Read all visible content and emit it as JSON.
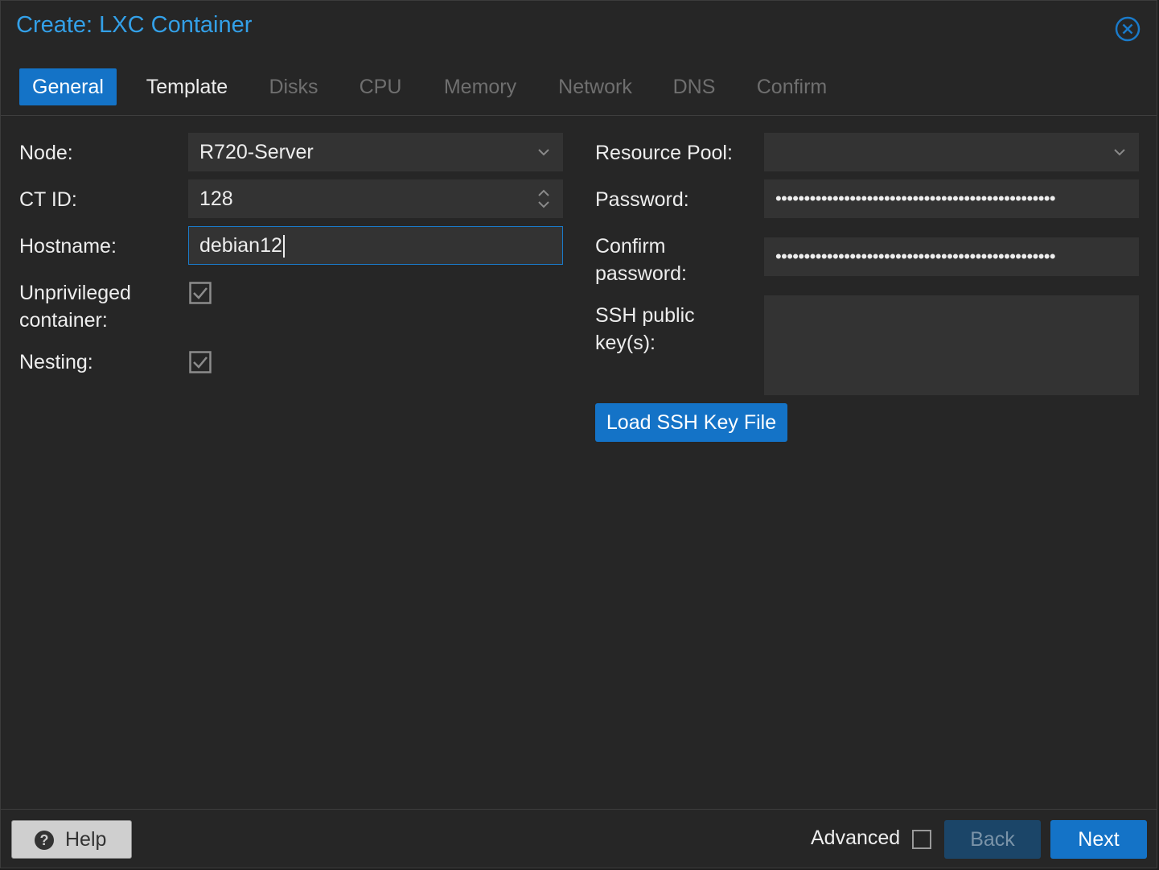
{
  "dialog": {
    "title": "Create: LXC Container"
  },
  "tabs": [
    {
      "label": "General",
      "state": "active"
    },
    {
      "label": "Template",
      "state": "enabled"
    },
    {
      "label": "Disks",
      "state": "disabled"
    },
    {
      "label": "CPU",
      "state": "disabled"
    },
    {
      "label": "Memory",
      "state": "disabled"
    },
    {
      "label": "Network",
      "state": "disabled"
    },
    {
      "label": "DNS",
      "state": "disabled"
    },
    {
      "label": "Confirm",
      "state": "disabled"
    }
  ],
  "left": {
    "node_label": "Node:",
    "node_value": "R720-Server",
    "ctid_label": "CT ID:",
    "ctid_value": "128",
    "hostname_label": "Hostname:",
    "hostname_value": "debian12",
    "unprivileged_label_1": "Unprivileged",
    "unprivileged_label_2": "container:",
    "unprivileged_checked": true,
    "nesting_label": "Nesting:",
    "nesting_checked": true
  },
  "right": {
    "pool_label": "Resource Pool:",
    "pool_value": "",
    "password_label": "Password:",
    "password_mask": "•••••••••••••••••••••••••••••••••••••••••••••••••",
    "confirm_label_1": "Confirm",
    "confirm_label_2": "password:",
    "confirm_mask": "•••••••••••••••••••••••••••••••••••••••••••••••••",
    "ssh_label_1": "SSH public",
    "ssh_label_2": "key(s):",
    "ssh_value": "",
    "load_ssh_button": "Load SSH Key File"
  },
  "footer": {
    "help_label": "Help",
    "advanced_label": "Advanced",
    "advanced_checked": false,
    "back_label": "Back",
    "next_label": "Next"
  },
  "colors": {
    "accent": "#1473c7",
    "title": "#33a0e8",
    "background": "#262626"
  }
}
